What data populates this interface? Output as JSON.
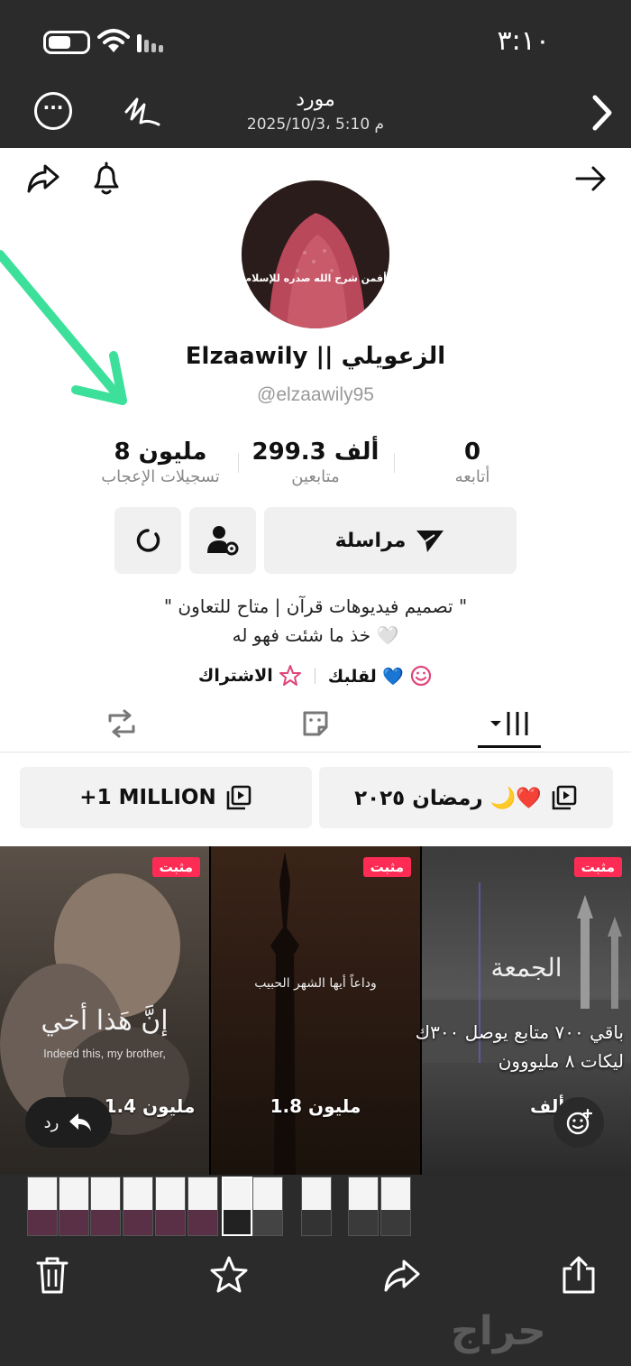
{
  "status": {
    "time": "٣:١٠"
  },
  "viewer": {
    "title": "مورد",
    "subtitle": "2025/10/3، 5:10 م"
  },
  "profile": {
    "display_name": "Elzaawily || الزعويلي",
    "handle": "@elzaawily95",
    "avatar_caption": "أفمن شرح الله صدره للإسلام",
    "stats": [
      {
        "number": "0",
        "label": "أتابعه"
      },
      {
        "number": "299.3 ألف",
        "label": "متابعين"
      },
      {
        "number": "8 مليون",
        "label": "تسجيلات الإعجاب"
      }
    ],
    "message_label": "مراسلة",
    "bio_line1": "\" تصميم فيديوهات قرآن | متاح للتعاون \"",
    "bio_line2": "خذ ما شئت فهو له 🤍",
    "link1": "لقلبك 💙",
    "link2": "الاشتراك"
  },
  "playlists": [
    {
      "label": "رمضان ٢٠٢٥ 🌙❤️"
    },
    {
      "label": "+1 MILLION"
    }
  ],
  "videos": [
    {
      "badge": "مثبت",
      "views": "ألف",
      "overlay_text": "الجمعة"
    },
    {
      "badge": "مثبت",
      "views": "1.8 مليون",
      "overlay_text": "وداعاً أيها الشهر الحبيب"
    },
    {
      "badge": "مثبت",
      "views": "1.4 مليون",
      "overlay_text": "إنَّ هَذا أخي",
      "overlay_sub": "Indeed this, my brother,"
    }
  ],
  "caption": {
    "line1": "باقي ٧٠٠ متابع يوصل ٣٠٠ك",
    "line2": "ليكات ٨ مليووون"
  },
  "reply_label": "رد",
  "watermark": "حراج",
  "colors": {
    "accent": "#fe2c55",
    "arrow": "#3de09a",
    "background": "#2b2b2b"
  }
}
